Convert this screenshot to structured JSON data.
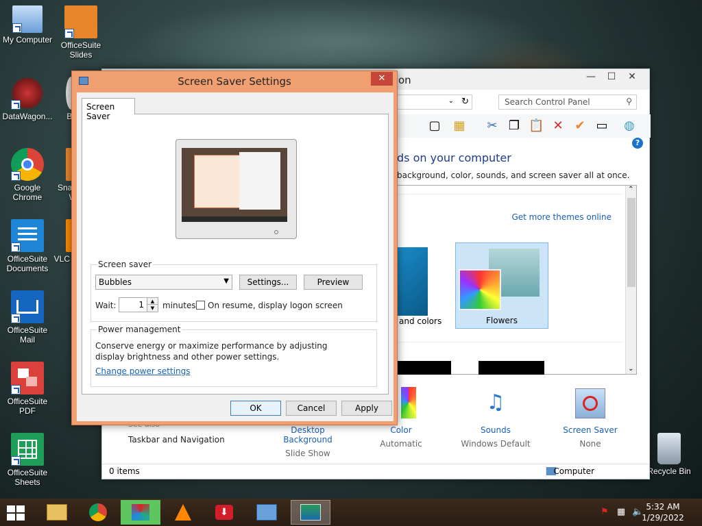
{
  "desktop": {
    "icons": [
      {
        "label": "My Computer",
        "icon": "computer-icon"
      },
      {
        "label": "OfficeSuite Slides",
        "icon": "slides-icon"
      },
      {
        "label": "DataWagon...",
        "icon": "datawagon-icon"
      },
      {
        "label": "Ba",
        "icon": "ba-icon"
      },
      {
        "label": "Google Chrome",
        "icon": "chrome-icon"
      },
      {
        "label": "Snap W",
        "icon": "snap-icon"
      },
      {
        "label": "OfficeSuite Documents",
        "icon": "documents-icon"
      },
      {
        "label": "VLC p",
        "icon": "vlc-icon"
      },
      {
        "label": "OfficeSuite Mail",
        "icon": "mail-icon"
      },
      {
        "label": "OfficeSuite PDF",
        "icon": "pdf-icon"
      },
      {
        "label": "OfficeSuite Sheets",
        "icon": "sheets-icon"
      },
      {
        "label": "Recycle Bin",
        "icon": "recycle-bin-icon"
      }
    ]
  },
  "control_panel": {
    "title_fragment": "on",
    "search_placeholder": "Search Control Panel",
    "heading_fragment": "ds on your computer",
    "sub_fragment": "background, color, sounds, and screen saver all at once.",
    "get_more_themes": "Get more themes online",
    "theme_selected": "Flowers",
    "theme_other_fragment": "and colors",
    "see_also_fragment": "See also",
    "taskbar_nav": "Taskbar and Navigation",
    "bottom_items": [
      {
        "label": "Desktop Background",
        "sub": "Slide Show"
      },
      {
        "label": "Color",
        "sub": "Automatic"
      },
      {
        "label": "Sounds",
        "sub": "Windows Default"
      },
      {
        "label": "Screen Saver",
        "sub": "None"
      }
    ],
    "status_items": "0 items",
    "status_location": "Computer"
  },
  "dialog": {
    "title": "Screen Saver Settings",
    "tab": "Screen Saver",
    "group_screensaver": "Screen saver",
    "selected_saver": "Bubbles",
    "settings_btn": "Settings...",
    "preview_btn": "Preview",
    "wait_label": "Wait:",
    "wait_value": "1",
    "minutes_label": "minutes",
    "resume_label": "On resume, display logon screen",
    "group_power": "Power management",
    "power_text": "Conserve energy or maximize performance by adjusting display brightness and other power settings.",
    "power_link": "Change power settings",
    "ok": "OK",
    "cancel": "Cancel",
    "apply": "Apply"
  },
  "taskbar": {
    "time": "5:32 AM",
    "date": "1/29/2022"
  }
}
